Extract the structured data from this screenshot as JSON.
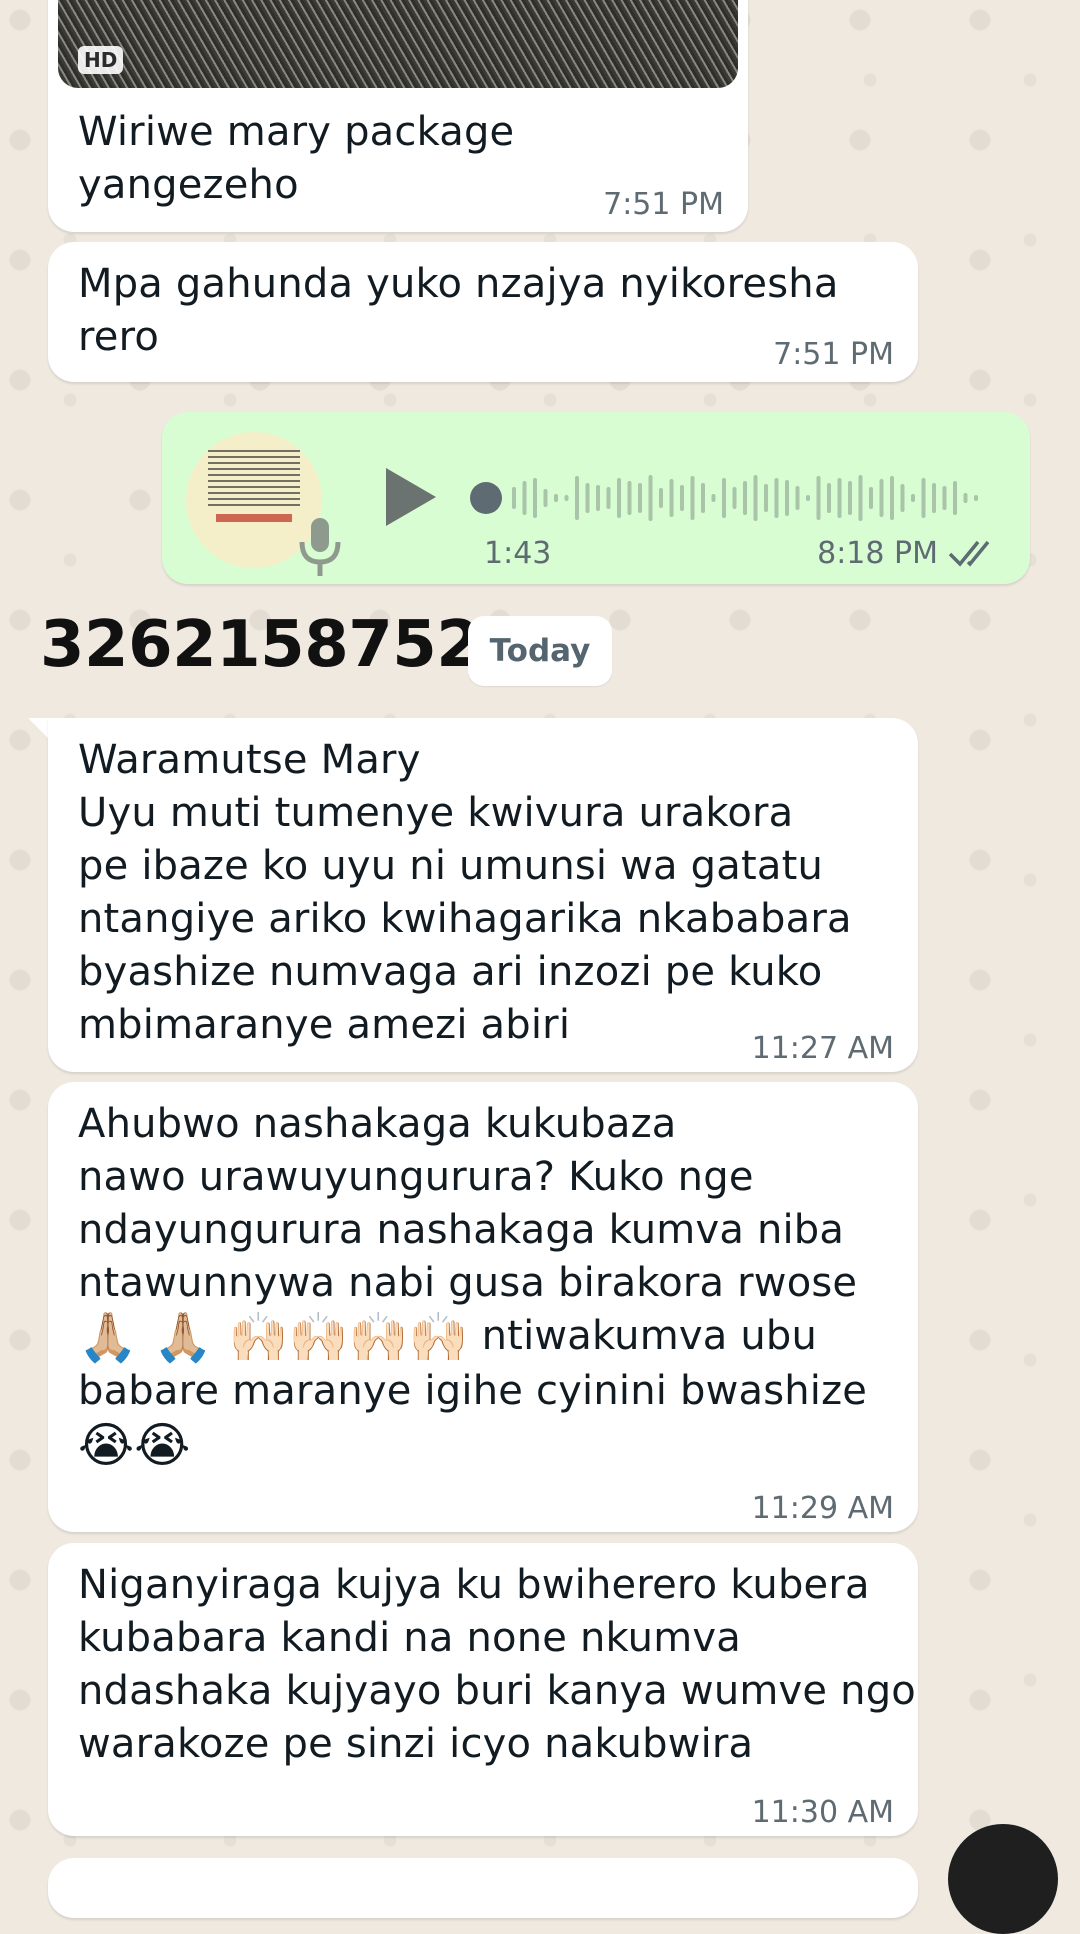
{
  "messages": {
    "image_message": {
      "badge": "HD",
      "text": "Wiriwe mary package\nyangezeho",
      "time": "7:51 PM"
    },
    "msg2": {
      "text": "Mpa gahunda yuko nzajya nyikoresha\nrero",
      "time": "7:51 PM"
    },
    "voice_note": {
      "duration": "1:43",
      "time": "8:18 PM",
      "status_icon": "double-check-icon",
      "play_icon": "play-icon",
      "mic_icon": "mic-icon"
    },
    "sender": {
      "name": "3262158752"
    },
    "date_chip": "Today",
    "msg3": {
      "text": "Waramutse Mary\nUyu muti tumenye kwivura urakora\npe ibaze ko uyu ni umunsi wa gatatu\nntangiye ariko kwihagarika nkababara\nbyashize numvaga ari inzozi pe kuko\nmbimaranye amezi abiri",
      "time": "11:27 AM"
    },
    "msg4": {
      "text_1": "Ahubwo nashakaga kukubaza\nnawo urawuyungurura? Kuko nge\nndayungurura nashakaga kumva niba\nntawunnywa nabi gusa birakora rwose\n",
      "emoji_line": "🙏🏼 🙏🏼 🙌🏻🙌🏻🙌🏻🙌🏻",
      "text_2": " ntiwakumva ubu\nbabare maranye igihe cyinini bwashize\n",
      "emoji_end": "😭😭",
      "time": "11:29 AM"
    },
    "msg5": {
      "text": "Niganyiraga kujya ku bwiherero kubera\nkubabara kandi na none nkumva\nndashaka kujyayo buri kanya wumve ngo\nwarakoze pe sinzi icyo nakubwira",
      "time": "11:30 AM"
    }
  },
  "colors": {
    "incoming_bubble": "#ffffff",
    "outgoing_bubble": "#d9fdd3",
    "wallpaper": "#efe9e0",
    "meta_text": "#5f6b72",
    "read_tick": "#5f6b72"
  }
}
